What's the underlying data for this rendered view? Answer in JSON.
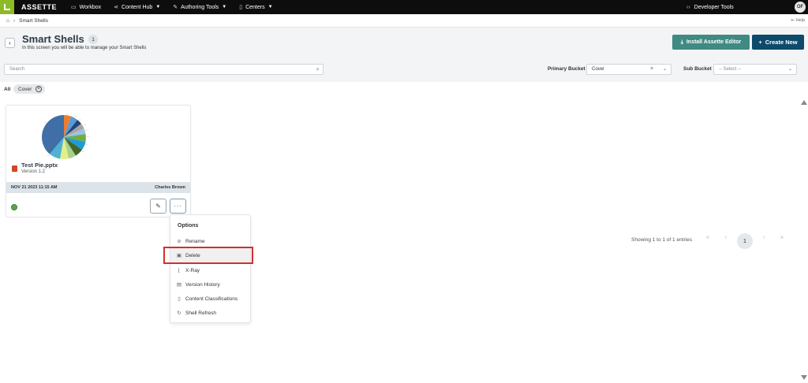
{
  "topnav": {
    "brand": "ASSETTE",
    "items": [
      {
        "label": "Workbox",
        "icon": "inbox-icon"
      },
      {
        "label": "Content Hub",
        "icon": "share-icon"
      },
      {
        "label": "Authoring Tools",
        "icon": "edit-icon"
      },
      {
        "label": "Centers",
        "icon": "building-icon"
      }
    ],
    "dev_tools": "Developer Tools",
    "avatar_initials": "OF"
  },
  "breadcrumb": {
    "items": [
      "Smart Shells"
    ],
    "help": "Help"
  },
  "header": {
    "title": "Smart Shells",
    "count": "1",
    "subtitle": "In this screen you will be able to manage your Smart Shells",
    "install_label": "Install Assette Editor",
    "create_label": "Create New"
  },
  "filters": {
    "search_placeholder": "Search",
    "primary_bucket_label": "Primary Bucket",
    "primary_bucket_value": "Cover",
    "sub_bucket_label": "Sub Bucket",
    "sub_bucket_value": "-- Select --"
  },
  "chips": {
    "all_label": "All",
    "active": "Cover"
  },
  "card": {
    "title": "Test Pie.pptx",
    "version": "Version 1.2",
    "date": "NOV 21 2023 11:15 AM",
    "author": "Charles Brown"
  },
  "menu": {
    "title": "Options",
    "items": [
      {
        "label": "Rename",
        "icon": "rename-icon"
      },
      {
        "label": "Delete",
        "icon": "trash-icon"
      },
      {
        "label": "X-Ray",
        "icon": "xray-icon"
      },
      {
        "label": "Version History",
        "icon": "history-icon"
      },
      {
        "label": "Content Classifications",
        "icon": "document-icon"
      },
      {
        "label": "Shell Refresh",
        "icon": "refresh-icon"
      }
    ]
  },
  "pagination": {
    "entries_text": "Showing 1 to 1 of 1 entries",
    "current_page": "1"
  },
  "colors": {
    "nav_bg": "#0d0d0d",
    "logo": "#8dbb27",
    "install_button": "#3f8a82",
    "create_button": "#0d4a6b",
    "highlight": "#d0302f"
  }
}
